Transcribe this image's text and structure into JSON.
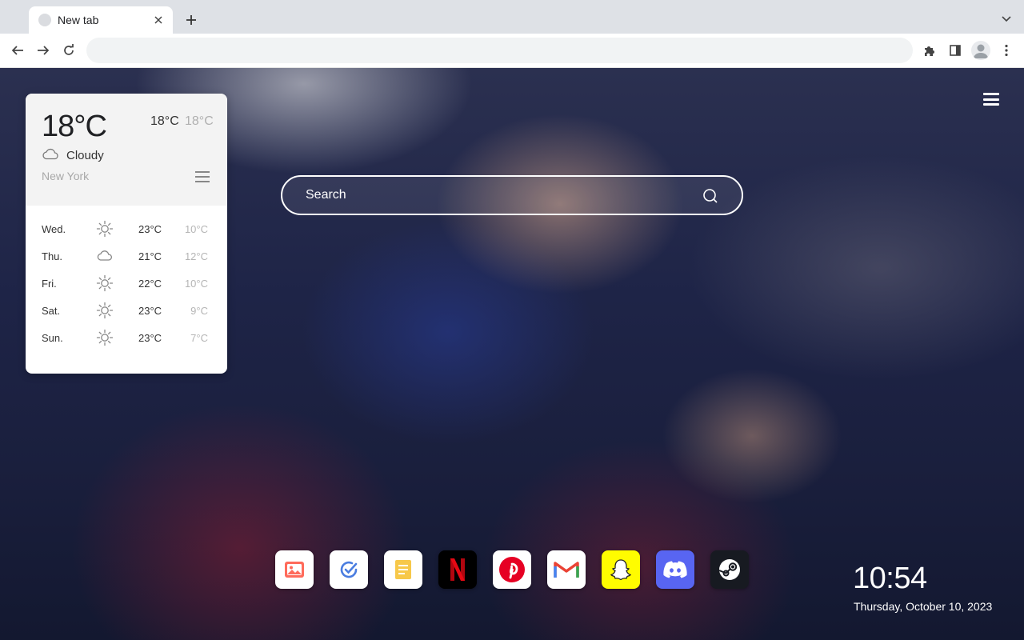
{
  "browser": {
    "tab": {
      "title": "New tab"
    },
    "omnibox": {
      "value": ""
    }
  },
  "weather": {
    "current": {
      "temp": "18°C",
      "high": "18°C",
      "low": "18°C",
      "condition": "Cloudy",
      "city": "New York",
      "icon": "cloud-icon"
    },
    "forecast": [
      {
        "day": "Wed.",
        "icon": "sun-icon",
        "high": "23°C",
        "low": "10°C"
      },
      {
        "day": "Thu.",
        "icon": "cloud-icon",
        "high": "21°C",
        "low": "12°C"
      },
      {
        "day": "Fri.",
        "icon": "sun-icon",
        "high": "22°C",
        "low": "10°C"
      },
      {
        "day": "Sat.",
        "icon": "sun-icon",
        "high": "23°C",
        "low": "9°C"
      },
      {
        "day": "Sun.",
        "icon": "sun-icon",
        "high": "23°C",
        "low": "7°C"
      }
    ]
  },
  "search": {
    "placeholder": "Search"
  },
  "dock": [
    {
      "name": "wallpaper",
      "icon": "image-icon"
    },
    {
      "name": "tasks",
      "icon": "check-icon"
    },
    {
      "name": "notes",
      "icon": "notes-icon"
    },
    {
      "name": "netflix",
      "icon": "netflix-icon",
      "glyph": "N"
    },
    {
      "name": "pinterest",
      "icon": "pinterest-icon",
      "glyph": "P"
    },
    {
      "name": "gmail",
      "icon": "gmail-icon",
      "glyph": "M"
    },
    {
      "name": "snapchat",
      "icon": "snapchat-icon"
    },
    {
      "name": "discord",
      "icon": "discord-icon"
    },
    {
      "name": "steam",
      "icon": "steam-icon"
    }
  ],
  "clock": {
    "time": "10:54",
    "date": "Thursday, October 10, 2023"
  },
  "colors": {
    "tabstrip": "#dee1e6",
    "netflix": "#e50914",
    "pinterest": "#e60023",
    "gmail": "#ea4335",
    "snapchat": "#fffc00",
    "discord": "#5865f2",
    "steam": "#171a21"
  }
}
